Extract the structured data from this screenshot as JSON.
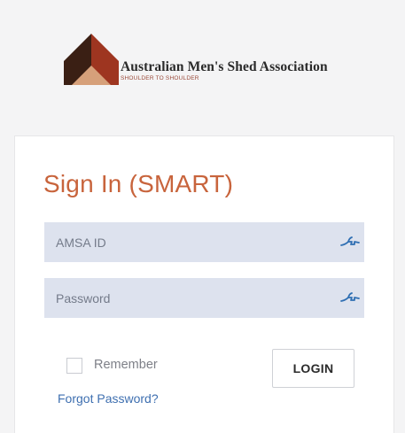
{
  "brand": {
    "name": "Australian Men's Shed Association",
    "tagline": "SHOULDER TO SHOULDER",
    "logo_icon": "shed-roof-logo-icon"
  },
  "login": {
    "title": "Sign In (SMART)",
    "id_field": {
      "placeholder": "AMSA ID",
      "value": "",
      "icon": "key-icon"
    },
    "password_field": {
      "placeholder": "Password",
      "value": "",
      "icon": "key-icon"
    },
    "remember_label": "Remember",
    "remember_checked": false,
    "login_button": "LOGIN",
    "forgot_link": "Forgot Password?"
  },
  "colors": {
    "title": "#c8643c",
    "field_bg": "#dde2ee",
    "icon": "#2f6fb3",
    "link": "#3e6fb0",
    "logo_dark": "#3a1f14",
    "logo_red": "#9e3520",
    "logo_tan": "#d6a07a"
  }
}
